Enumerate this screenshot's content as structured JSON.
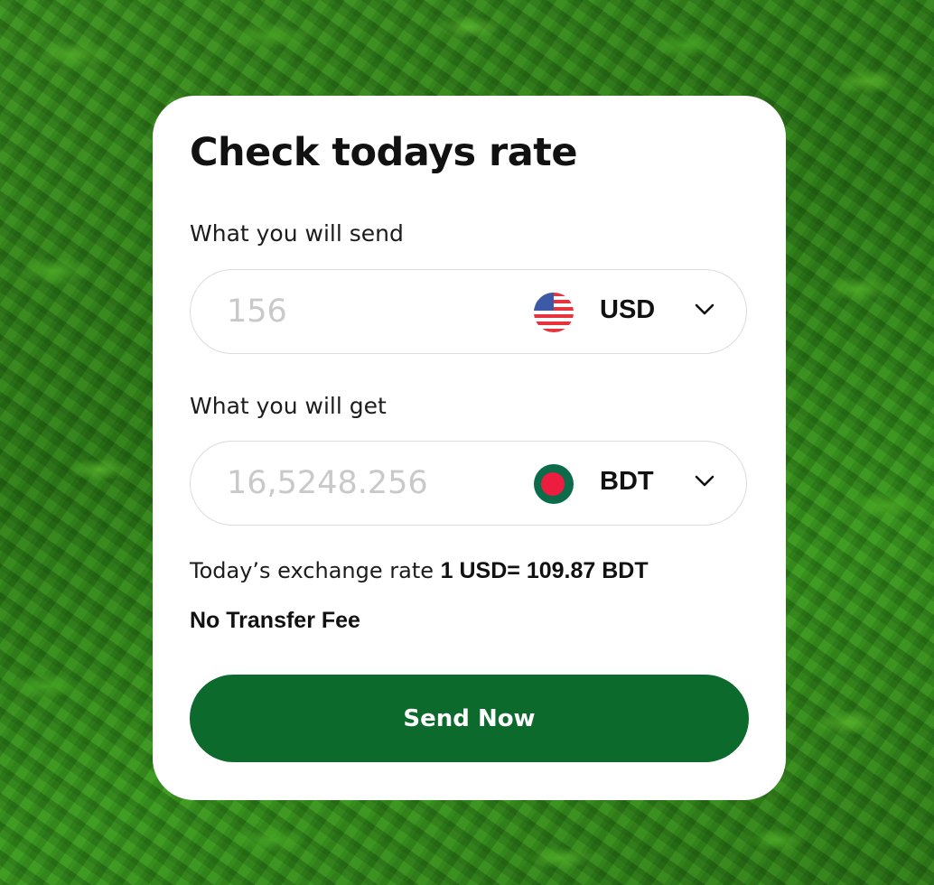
{
  "card": {
    "title": "Check todays rate"
  },
  "send": {
    "label": "What you will send",
    "amount_placeholder": "156",
    "currency": "USD",
    "flag_icon": "us-flag-icon"
  },
  "get": {
    "label": "What you will get",
    "amount_placeholder": "16,5248.256",
    "currency": "BDT",
    "flag_icon": "bd-flag-icon"
  },
  "rate": {
    "prefix": "Today’s exchange rate",
    "value": "1 USD= 109.87 BDT"
  },
  "fee": {
    "text": "No Transfer Fee"
  },
  "action": {
    "send_label": "Send Now"
  },
  "colors": {
    "button": "#0b6a2c",
    "card": "#ffffff",
    "placeholder": "#c9c9c9"
  }
}
